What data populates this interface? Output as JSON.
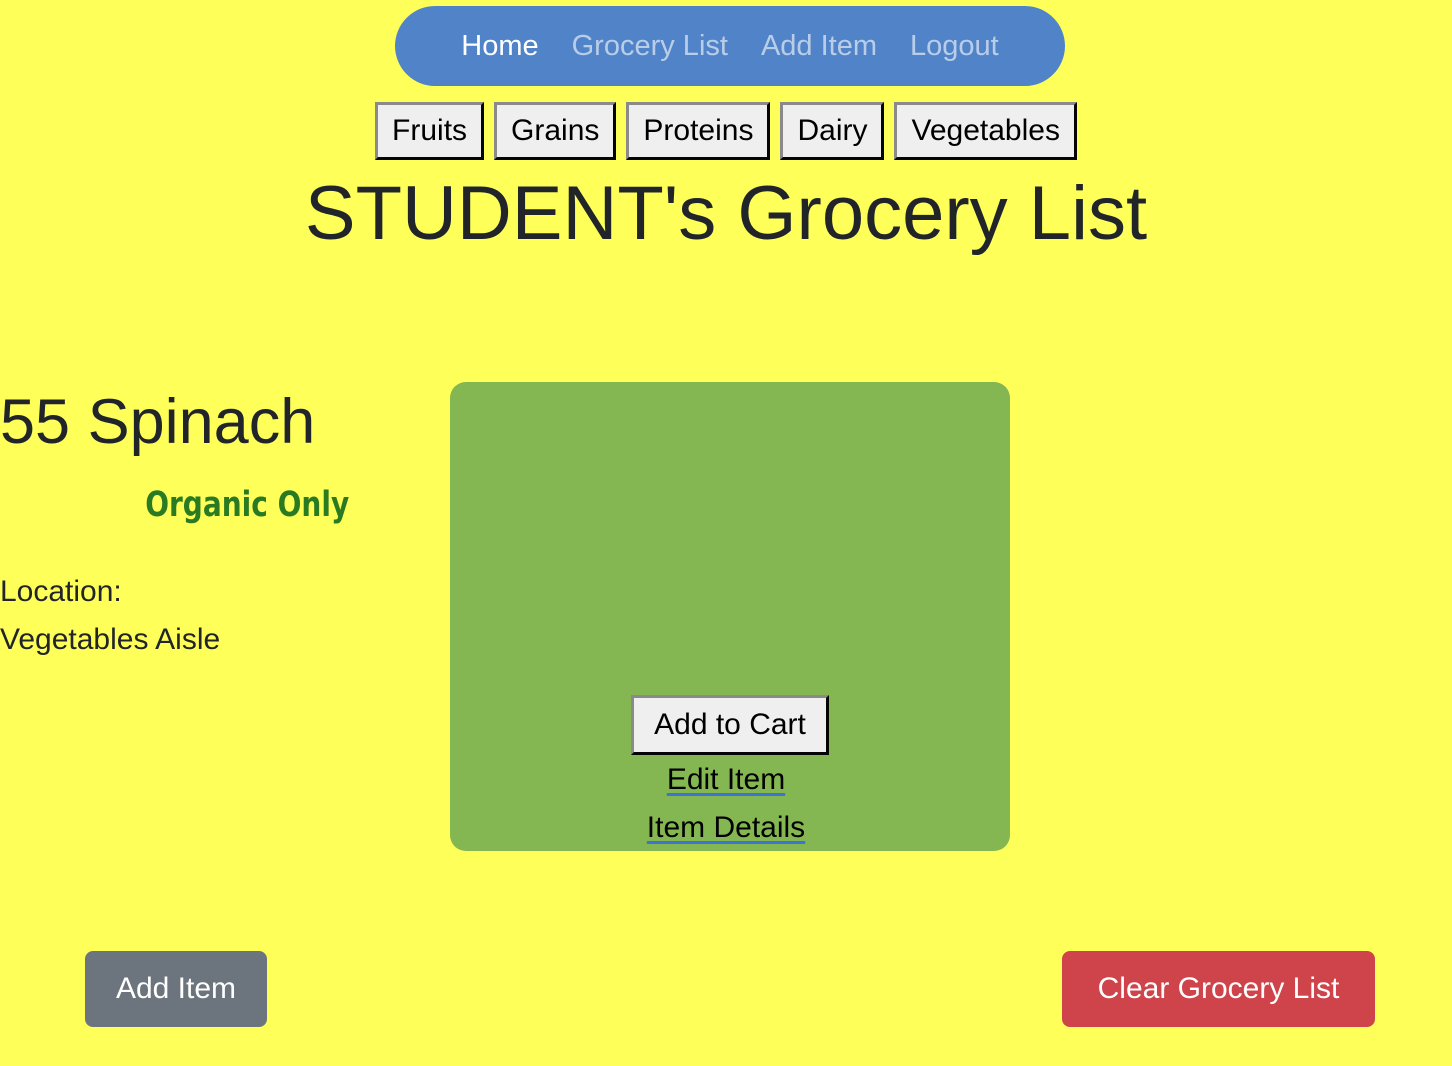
{
  "nav": {
    "items": [
      {
        "label": "Home"
      },
      {
        "label": "Grocery List"
      },
      {
        "label": "Add Item"
      },
      {
        "label": "Logout"
      }
    ]
  },
  "filters": [
    {
      "label": "Fruits"
    },
    {
      "label": "Grains"
    },
    {
      "label": "Proteins"
    },
    {
      "label": "Dairy"
    },
    {
      "label": "Vegetables"
    }
  ],
  "page_title": "STUDENT's Grocery List",
  "card": {
    "title": "55 Spinach",
    "note": "Organic Only",
    "location_label": "Location:",
    "location_value": "Vegetables Aisle",
    "add_to_cart_label": "Add to Cart",
    "edit_link": "Edit Item",
    "details_link": "Item Details"
  },
  "bottom": {
    "add_item_label": "Add Item",
    "clear_label": "Clear Grocery List"
  },
  "colors": {
    "page_background": "#ffff5a",
    "nav_background": "#5083c7",
    "card_background": "#84b752",
    "note_color": "#2a7a22",
    "add_item_button": "#6c757d",
    "clear_button": "#cf444b"
  }
}
